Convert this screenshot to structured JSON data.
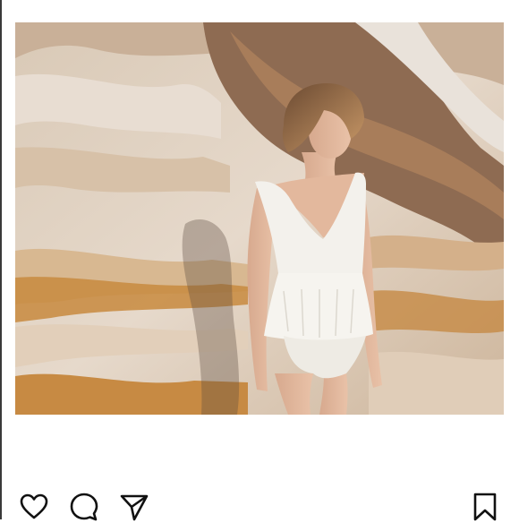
{
  "post": {
    "image": {
      "alt": "",
      "subject": "woman-in-white-peplum-swimsuit-against-sandstone-rock"
    },
    "actions": {
      "like_icon": "heart-icon",
      "comment_icon": "comment-bubble-icon",
      "share_icon": "paper-plane-icon",
      "save_icon": "bookmark-icon"
    }
  },
  "colors": {
    "background": "#ffffff",
    "icon_stroke": "#111111",
    "rock_light": "#e8ddd2",
    "rock_ochre": "#c8893e",
    "swimsuit": "#f3f1ec"
  }
}
